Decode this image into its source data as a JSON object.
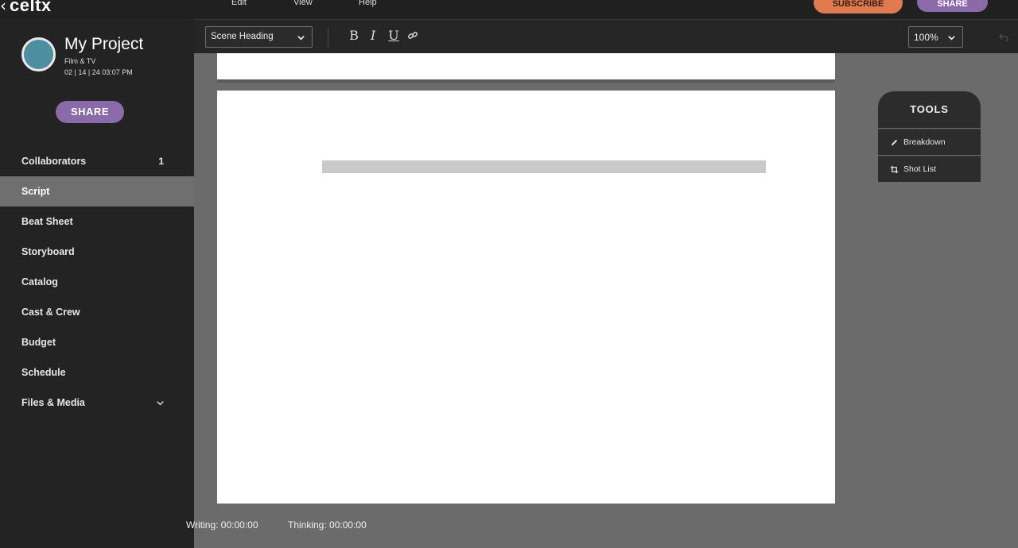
{
  "brand": {
    "back": "‹",
    "name": "celtx"
  },
  "menu": [
    "Edit",
    "View",
    "Help"
  ],
  "top_buttons": {
    "subscribe": "SUBSCRIBE",
    "share": "SHARE"
  },
  "project": {
    "title": "My Project",
    "type": "Film & TV",
    "date": "02 | 14 | 24 03:07 PM",
    "share_label": "SHARE"
  },
  "nav": {
    "items": [
      {
        "label": "Collaborators",
        "count": "1"
      },
      {
        "label": "Script"
      },
      {
        "label": "Beat Sheet"
      },
      {
        "label": "Storyboard"
      },
      {
        "label": "Catalog"
      },
      {
        "label": "Cast & Crew"
      },
      {
        "label": "Budget"
      },
      {
        "label": "Schedule"
      },
      {
        "label": "Files & Media"
      }
    ],
    "active": "Script"
  },
  "toolbar": {
    "format": "Scene Heading",
    "bold": "B",
    "italic": "I",
    "underline": "U",
    "zoom": "100%"
  },
  "tools": {
    "title": "TOOLS",
    "items": [
      {
        "label": "Breakdown"
      },
      {
        "label": "Shot List"
      }
    ]
  },
  "status": {
    "writing": "Writing: 00:00:00",
    "thinking": "Thinking: 00:00:00"
  },
  "colors": {
    "subscribe": "#e07a4f",
    "share": "#8a6aa8",
    "avatar": "#4d8fa0",
    "sidebar": "#232323",
    "active_nav": "#6f6f6f"
  }
}
